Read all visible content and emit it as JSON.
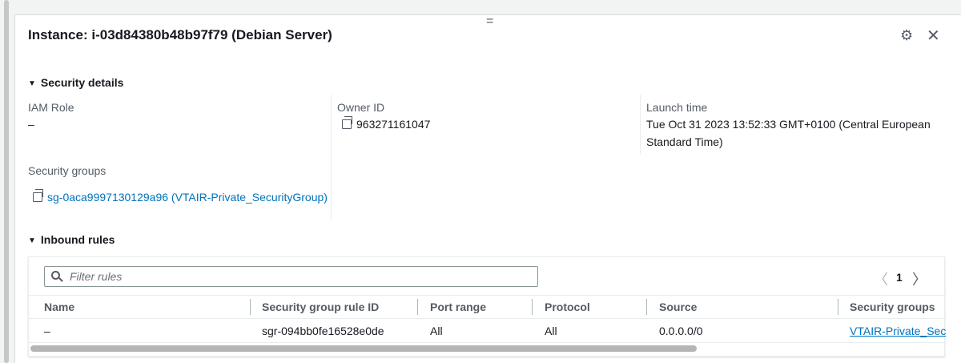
{
  "panel": {
    "title": "Instance: i-03d84380b48b97f79 (Debian Server)",
    "handle": "="
  },
  "security_details": {
    "heading": "Security details",
    "iam_role": {
      "label": "IAM Role",
      "value": "–"
    },
    "owner_id": {
      "label": "Owner ID",
      "value": "963271161047"
    },
    "launch_time": {
      "label": "Launch time",
      "value_line1": "Tue Oct 31 2023 13:52:33 GMT+0100 (Central European",
      "value_line2": "Standard Time)"
    },
    "security_groups": {
      "label": "Security groups",
      "value": "sg-0aca9997130129a96 (VTAIR-Private_SecurityGroup)"
    }
  },
  "inbound_rules": {
    "heading": "Inbound rules",
    "filter_placeholder": "Filter rules",
    "page": "1",
    "columns": [
      "Name",
      "Security group rule ID",
      "Port range",
      "Protocol",
      "Source",
      "Security groups"
    ],
    "rows": [
      [
        "–",
        "sgr-094bb0fe16528e0de",
        "All",
        "All",
        "0.0.0.0/0",
        "VTAIR-Private_Secu"
      ]
    ]
  },
  "colors": {
    "link": "#0073bb",
    "text": "#16191f"
  }
}
